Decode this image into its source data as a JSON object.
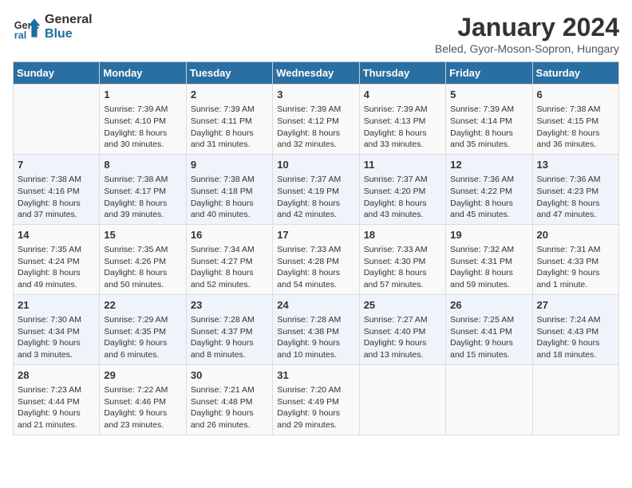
{
  "logo": {
    "line1": "General",
    "line2": "Blue"
  },
  "title": "January 2024",
  "subtitle": "Beled, Gyor-Moson-Sopron, Hungary",
  "days_header": [
    "Sunday",
    "Monday",
    "Tuesday",
    "Wednesday",
    "Thursday",
    "Friday",
    "Saturday"
  ],
  "weeks": [
    [
      {
        "num": "",
        "info": ""
      },
      {
        "num": "1",
        "info": "Sunrise: 7:39 AM\nSunset: 4:10 PM\nDaylight: 8 hours\nand 30 minutes."
      },
      {
        "num": "2",
        "info": "Sunrise: 7:39 AM\nSunset: 4:11 PM\nDaylight: 8 hours\nand 31 minutes."
      },
      {
        "num": "3",
        "info": "Sunrise: 7:39 AM\nSunset: 4:12 PM\nDaylight: 8 hours\nand 32 minutes."
      },
      {
        "num": "4",
        "info": "Sunrise: 7:39 AM\nSunset: 4:13 PM\nDaylight: 8 hours\nand 33 minutes."
      },
      {
        "num": "5",
        "info": "Sunrise: 7:39 AM\nSunset: 4:14 PM\nDaylight: 8 hours\nand 35 minutes."
      },
      {
        "num": "6",
        "info": "Sunrise: 7:38 AM\nSunset: 4:15 PM\nDaylight: 8 hours\nand 36 minutes."
      }
    ],
    [
      {
        "num": "7",
        "info": "Sunrise: 7:38 AM\nSunset: 4:16 PM\nDaylight: 8 hours\nand 37 minutes."
      },
      {
        "num": "8",
        "info": "Sunrise: 7:38 AM\nSunset: 4:17 PM\nDaylight: 8 hours\nand 39 minutes."
      },
      {
        "num": "9",
        "info": "Sunrise: 7:38 AM\nSunset: 4:18 PM\nDaylight: 8 hours\nand 40 minutes."
      },
      {
        "num": "10",
        "info": "Sunrise: 7:37 AM\nSunset: 4:19 PM\nDaylight: 8 hours\nand 42 minutes."
      },
      {
        "num": "11",
        "info": "Sunrise: 7:37 AM\nSunset: 4:20 PM\nDaylight: 8 hours\nand 43 minutes."
      },
      {
        "num": "12",
        "info": "Sunrise: 7:36 AM\nSunset: 4:22 PM\nDaylight: 8 hours\nand 45 minutes."
      },
      {
        "num": "13",
        "info": "Sunrise: 7:36 AM\nSunset: 4:23 PM\nDaylight: 8 hours\nand 47 minutes."
      }
    ],
    [
      {
        "num": "14",
        "info": "Sunrise: 7:35 AM\nSunset: 4:24 PM\nDaylight: 8 hours\nand 49 minutes."
      },
      {
        "num": "15",
        "info": "Sunrise: 7:35 AM\nSunset: 4:26 PM\nDaylight: 8 hours\nand 50 minutes."
      },
      {
        "num": "16",
        "info": "Sunrise: 7:34 AM\nSunset: 4:27 PM\nDaylight: 8 hours\nand 52 minutes."
      },
      {
        "num": "17",
        "info": "Sunrise: 7:33 AM\nSunset: 4:28 PM\nDaylight: 8 hours\nand 54 minutes."
      },
      {
        "num": "18",
        "info": "Sunrise: 7:33 AM\nSunset: 4:30 PM\nDaylight: 8 hours\nand 57 minutes."
      },
      {
        "num": "19",
        "info": "Sunrise: 7:32 AM\nSunset: 4:31 PM\nDaylight: 8 hours\nand 59 minutes."
      },
      {
        "num": "20",
        "info": "Sunrise: 7:31 AM\nSunset: 4:33 PM\nDaylight: 9 hours\nand 1 minute."
      }
    ],
    [
      {
        "num": "21",
        "info": "Sunrise: 7:30 AM\nSunset: 4:34 PM\nDaylight: 9 hours\nand 3 minutes."
      },
      {
        "num": "22",
        "info": "Sunrise: 7:29 AM\nSunset: 4:35 PM\nDaylight: 9 hours\nand 6 minutes."
      },
      {
        "num": "23",
        "info": "Sunrise: 7:28 AM\nSunset: 4:37 PM\nDaylight: 9 hours\nand 8 minutes."
      },
      {
        "num": "24",
        "info": "Sunrise: 7:28 AM\nSunset: 4:38 PM\nDaylight: 9 hours\nand 10 minutes."
      },
      {
        "num": "25",
        "info": "Sunrise: 7:27 AM\nSunset: 4:40 PM\nDaylight: 9 hours\nand 13 minutes."
      },
      {
        "num": "26",
        "info": "Sunrise: 7:25 AM\nSunset: 4:41 PM\nDaylight: 9 hours\nand 15 minutes."
      },
      {
        "num": "27",
        "info": "Sunrise: 7:24 AM\nSunset: 4:43 PM\nDaylight: 9 hours\nand 18 minutes."
      }
    ],
    [
      {
        "num": "28",
        "info": "Sunrise: 7:23 AM\nSunset: 4:44 PM\nDaylight: 9 hours\nand 21 minutes."
      },
      {
        "num": "29",
        "info": "Sunrise: 7:22 AM\nSunset: 4:46 PM\nDaylight: 9 hours\nand 23 minutes."
      },
      {
        "num": "30",
        "info": "Sunrise: 7:21 AM\nSunset: 4:48 PM\nDaylight: 9 hours\nand 26 minutes."
      },
      {
        "num": "31",
        "info": "Sunrise: 7:20 AM\nSunset: 4:49 PM\nDaylight: 9 hours\nand 29 minutes."
      },
      {
        "num": "",
        "info": ""
      },
      {
        "num": "",
        "info": ""
      },
      {
        "num": "",
        "info": ""
      }
    ]
  ]
}
